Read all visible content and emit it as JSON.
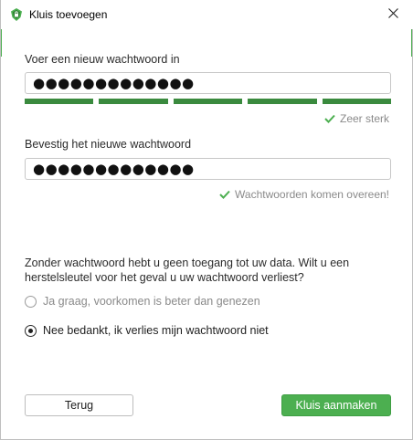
{
  "window": {
    "title": "Kluis toevoegen",
    "accent_color": "#4caf50"
  },
  "icons": {
    "app": "cryptomator-icon",
    "close": "close-icon",
    "check": "check-icon"
  },
  "new_password": {
    "label": "Voer een nieuw wachtwoord in",
    "value": "●●●●●●●●●●●●●",
    "strength_segments_filled": 5,
    "strength_segments_total": 5,
    "strength_color": "#3a8a3e",
    "strength_text": "Zeer sterk"
  },
  "confirm_password": {
    "label": "Bevestig het nieuwe wachtwoord",
    "value": "●●●●●●●●●●●●●",
    "match_text": "Wachtwoorden komen overeen!"
  },
  "recovery": {
    "info": "Zonder wachtwoord hebt u geen toegang tot uw data. Wilt u een herstelsleutel voor het geval u uw wachtwoord verliest?",
    "options": [
      {
        "label": "Ja graag, voorkomen is beter dan genezen",
        "selected": false
      },
      {
        "label": "Nee bedankt, ik verlies mijn wachtwoord niet",
        "selected": true
      }
    ]
  },
  "buttons": {
    "back": "Terug",
    "create": "Kluis aanmaken"
  }
}
